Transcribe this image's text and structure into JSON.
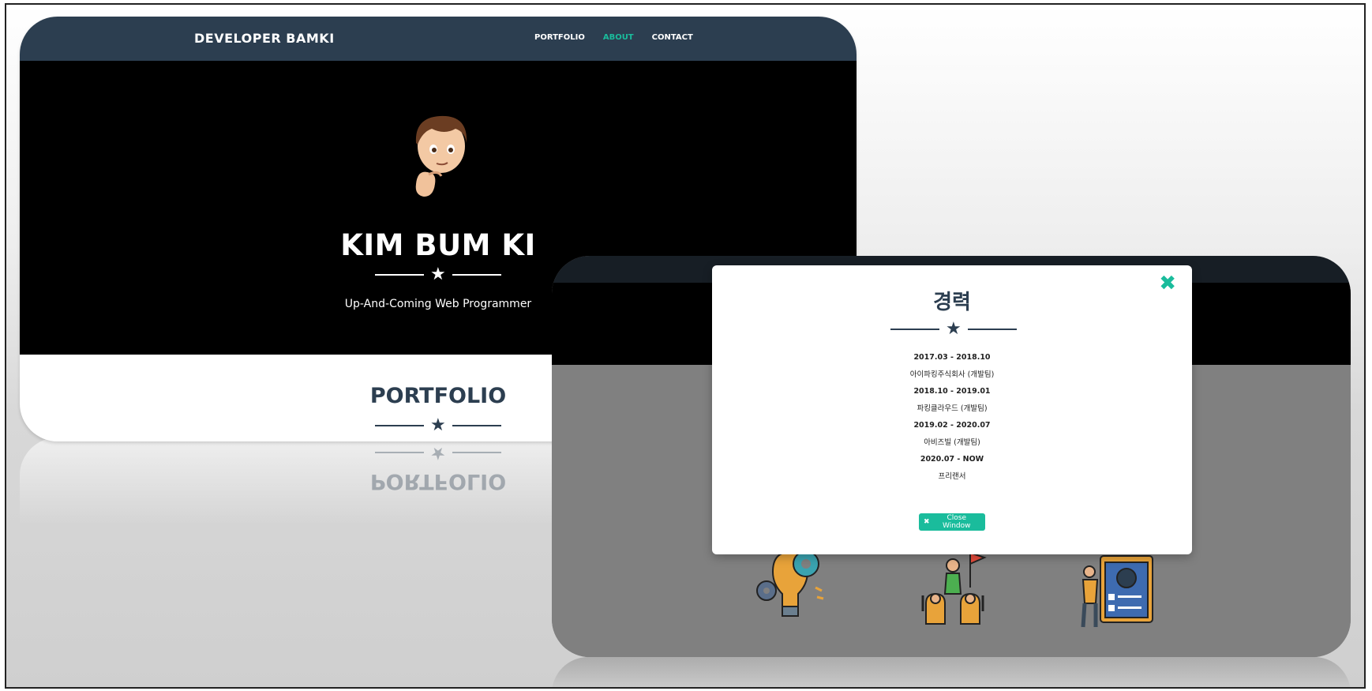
{
  "site": {
    "brand": "DEVELOPER BAMKI",
    "nav": [
      {
        "label": "PORTFOLIO",
        "active": false
      },
      {
        "label": "ABOUT",
        "active": true
      },
      {
        "label": "CONTACT",
        "active": false
      }
    ],
    "hero": {
      "name": "KIM BUM KI",
      "subtitle": "Up-And-Coming Web Programmer"
    },
    "section_title": "PORTFOLIO"
  },
  "modal": {
    "title": "경력",
    "career": [
      {
        "period": "2017.03 - 2018.10",
        "company": "아이파킹주식회사 (개발팀)"
      },
      {
        "period": "2018.10 - 2019.01",
        "company": "파킹클라우드 (개발팀)"
      },
      {
        "period": "2019.02 - 2020.07",
        "company": "아비즈빌 (개발팀)"
      },
      {
        "period": "2020.07 - NOW",
        "company": "프리랜서"
      }
    ],
    "close_label": "Close Window",
    "close_x": "✖"
  },
  "colors": {
    "navy": "#2c3e50",
    "accent": "#1abc9c",
    "hero_bg": "#000000"
  },
  "icons": [
    "star-icon",
    "close-x-icon",
    "memoji-avatar",
    "lightbulb-gears-illustration",
    "team-flag-illustration",
    "clipboard-presenter-illustration"
  ]
}
